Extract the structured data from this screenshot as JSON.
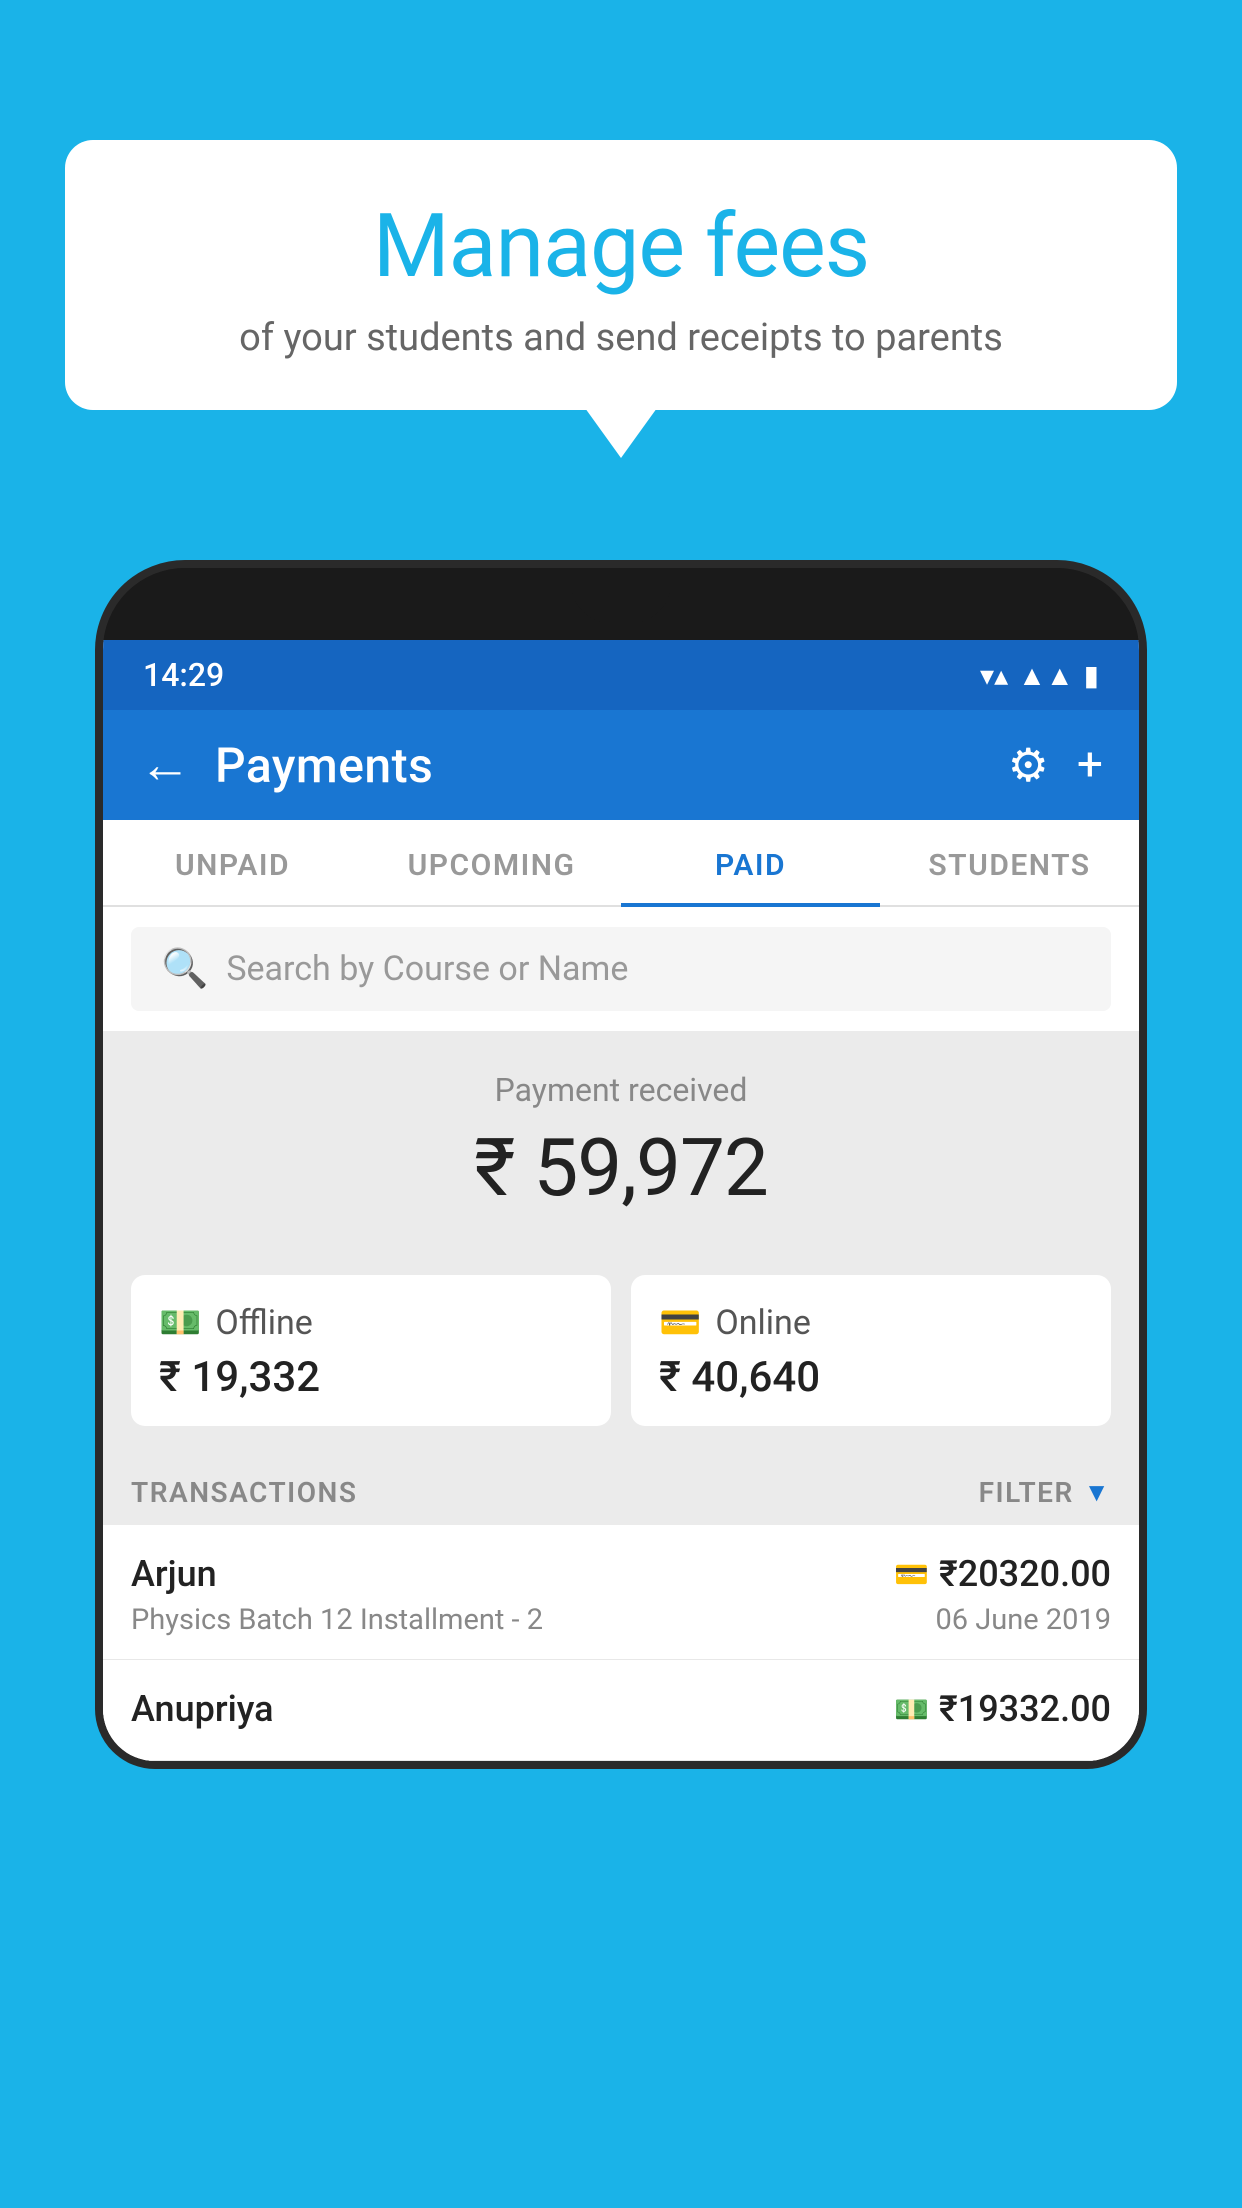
{
  "page": {
    "background_color": "#1ab3e8"
  },
  "speech_bubble": {
    "title": "Manage fees",
    "subtitle": "of your students and send receipts to parents"
  },
  "status_bar": {
    "time": "14:29",
    "wifi": "▼",
    "signal": "▲",
    "battery": "▮"
  },
  "app_bar": {
    "title": "Payments",
    "back_label": "←",
    "gear_label": "⚙",
    "add_label": "+"
  },
  "tabs": [
    {
      "id": "unpaid",
      "label": "UNPAID",
      "active": false
    },
    {
      "id": "upcoming",
      "label": "UPCOMING",
      "active": false
    },
    {
      "id": "paid",
      "label": "PAID",
      "active": true
    },
    {
      "id": "students",
      "label": "STUDENTS",
      "active": false
    }
  ],
  "search": {
    "placeholder": "Search by Course or Name"
  },
  "payment_summary": {
    "label": "Payment received",
    "amount": "₹ 59,972",
    "offline": {
      "label": "Offline",
      "amount": "₹ 19,332"
    },
    "online": {
      "label": "Online",
      "amount": "₹ 40,640"
    }
  },
  "transactions_section": {
    "header_label": "TRANSACTIONS",
    "filter_label": "FILTER"
  },
  "transactions": [
    {
      "name": "Arjun",
      "course": "Physics Batch 12 Installment - 2",
      "amount": "₹20320.00",
      "date": "06 June 2019",
      "payment_mode": "card"
    },
    {
      "name": "Anupriya",
      "course": "",
      "amount": "₹19332.00",
      "date": "",
      "payment_mode": "cash"
    }
  ]
}
